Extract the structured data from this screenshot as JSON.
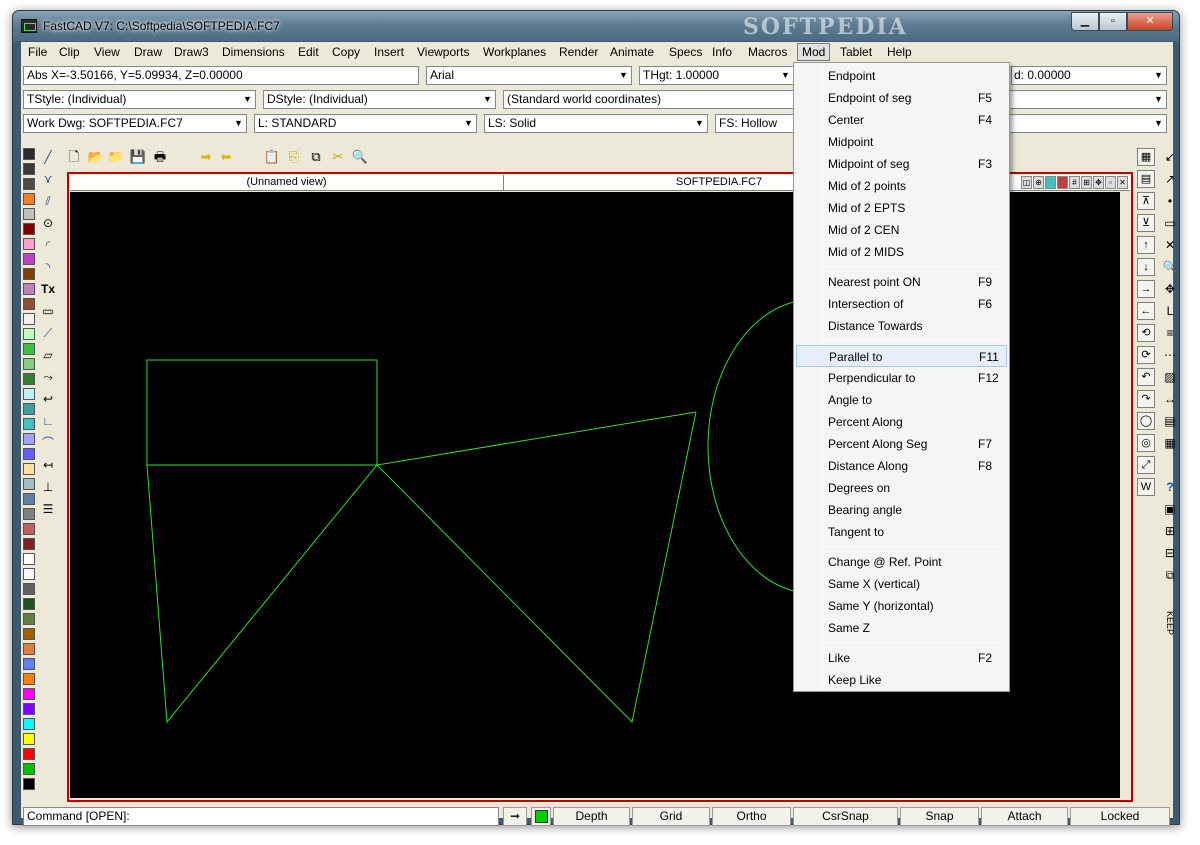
{
  "window": {
    "title": "FastCAD V7: C:\\Softpedia\\SOFTPEDIA.FC7",
    "watermark": "SOFTPEDIA"
  },
  "menu": [
    "File",
    "Clip",
    "View",
    "Draw",
    "Draw3",
    "Dimensions",
    "Edit",
    "Copy",
    "Insert",
    "Viewports",
    "Workplanes",
    "Render",
    "Animate",
    "Specs",
    "Info",
    "Macros",
    "Mod",
    "Tablet",
    "Help"
  ],
  "active_menu": "Mod",
  "toolbar": {
    "coords": "Abs X=-3.50166, Y=5.09934, Z=0.00000",
    "font": "Arial",
    "thgt": "THgt: 1.00000",
    "rot": "d: 0.00000",
    "tstyle": "TStyle: (Individual)",
    "dstyle": "DStyle: (Individual)",
    "coordsys": "(Standard world coordinates)",
    "workdwg": "Work Dwg: SOFTPEDIA.FC7",
    "layer": "L: STANDARD",
    "linestyle": "LS: Solid",
    "fillstyle": "FS: Hollow"
  },
  "view": {
    "left_title": "(Unnamed view)",
    "right_title": "SOFTPEDIA.FC7",
    "line_color": "#33dd33",
    "canvas_bg": "#000000"
  },
  "palette": [
    "#2b2b2b",
    "#3a3a3a",
    "#4a4a4a",
    "#f08020",
    "#c0c0c0",
    "#800000",
    "#ff9fd0",
    "#c040c0",
    "#804000",
    "#c080c0",
    "#905030",
    "#f0f0f0",
    "#c0ffc0",
    "#40c040",
    "#80d080",
    "#308030",
    "#c0f0ff",
    "#40a0a0",
    "#40c0c0",
    "#a0a0ff",
    "#6060ff",
    "#ffe0a0",
    "#a0c0c0",
    "#6080a0",
    "#808080",
    "#c06060",
    "#802020",
    "#ffffff",
    "#f8f8f8",
    "#606060",
    "#205020",
    "#608040",
    "#a06000",
    "#e08040",
    "#6080ff",
    "#ff8000",
    "#ff00ff",
    "#8000ff",
    "#00ffff",
    "#ffff00",
    "#ff0000",
    "#00c000",
    "#000000"
  ],
  "right_tools": [
    "grid-icon",
    "layers-icon",
    "move-up-icon",
    "move-down-icon",
    "arrow-up-icon",
    "arrow-down-icon",
    "arrow-right-icon",
    "arrow-left-icon",
    "rotate-icon",
    "rotate2-icon",
    "turn-left-icon",
    "turn-right-icon",
    "circle-icon",
    "circle2-icon",
    "scale-icon",
    "W"
  ],
  "right_tools2": [
    "↙",
    "↗",
    "•",
    "▭",
    "✕",
    "🔍",
    "✥",
    "L",
    "≡",
    "⋯",
    "▨",
    "↔",
    "▤",
    "▦",
    "?",
    "▣",
    "⊞",
    "⊟",
    "⧉",
    "KEEP"
  ],
  "mod_menu": {
    "groups": [
      [
        {
          "label": "Endpoint",
          "key": ""
        },
        {
          "label": "Endpoint of seg",
          "key": "F5"
        },
        {
          "label": "Center",
          "key": "F4"
        },
        {
          "label": "Midpoint",
          "key": ""
        },
        {
          "label": "Midpoint of seg",
          "key": "F3"
        },
        {
          "label": "Mid of 2 points",
          "key": ""
        },
        {
          "label": "Mid of 2 EPTS",
          "key": ""
        },
        {
          "label": "Mid of 2 CEN",
          "key": ""
        },
        {
          "label": "Mid of 2 MIDS",
          "key": ""
        }
      ],
      [
        {
          "label": "Nearest point ON",
          "key": "F9"
        },
        {
          "label": "Intersection of",
          "key": "F6"
        },
        {
          "label": "Distance Towards",
          "key": ""
        }
      ],
      [
        {
          "label": "Parallel to",
          "key": "F11"
        },
        {
          "label": "Perpendicular to",
          "key": "F12"
        },
        {
          "label": "Angle to",
          "key": ""
        },
        {
          "label": "Percent Along",
          "key": ""
        },
        {
          "label": "Percent Along Seg",
          "key": "F7"
        },
        {
          "label": "Distance Along",
          "key": "F8"
        },
        {
          "label": "Degrees on",
          "key": ""
        },
        {
          "label": "Bearing angle",
          "key": ""
        },
        {
          "label": "Tangent to",
          "key": ""
        }
      ],
      [
        {
          "label": "Change @ Ref. Point",
          "key": ""
        },
        {
          "label": "Same X (vertical)",
          "key": ""
        },
        {
          "label": "Same Y (horizontal)",
          "key": ""
        },
        {
          "label": "Same Z",
          "key": ""
        }
      ],
      [
        {
          "label": "Like",
          "key": "F2"
        },
        {
          "label": "Keep Like",
          "key": ""
        }
      ]
    ],
    "highlighted": "Parallel to"
  },
  "status": {
    "command": "Command [OPEN]:",
    "buttons": [
      "Depth",
      "Grid",
      "Ortho",
      "CsrSnap",
      "Snap",
      "Attach",
      "Locked"
    ],
    "snap_color": "#00cc00"
  }
}
